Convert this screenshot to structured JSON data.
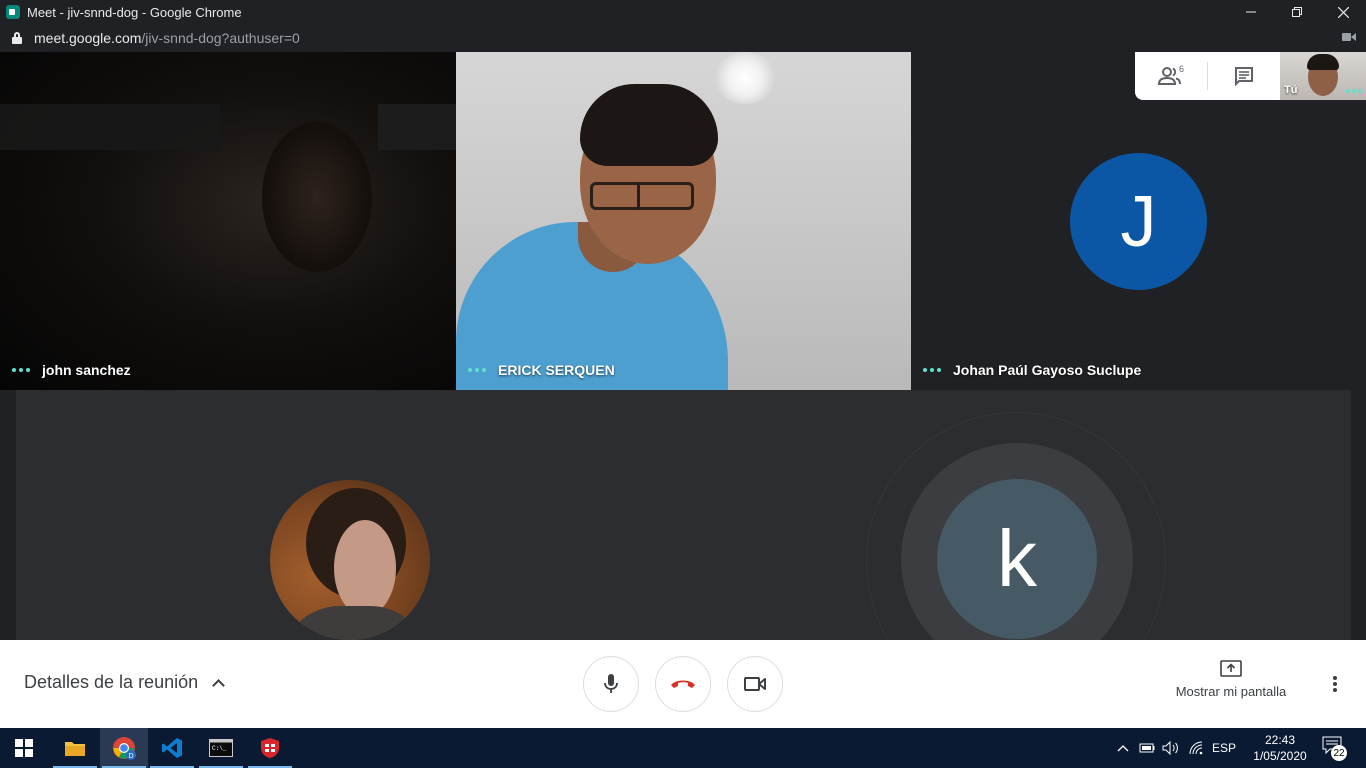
{
  "window": {
    "title": "Meet - jiv-snnd-dog - Google Chrome",
    "url_host": "meet.google.com",
    "url_path": "/jiv-snnd-dog?authuser=0"
  },
  "participants": [
    {
      "name": "john sanchez"
    },
    {
      "name": "ERICK SERQUEN"
    },
    {
      "name": "Johan Paúl Gayoso Suclupe",
      "initial": "J",
      "avatar_color": "#0b57a5"
    },
    {
      "name": "",
      "initial": "k",
      "avatar_color": "#455a64"
    }
  ],
  "top_panel": {
    "people_count": "6",
    "self_label": "Tú"
  },
  "controls": {
    "details_label": "Detalles de la reunión",
    "present_label": "Mostrar mi pantalla",
    "end_call_color": "#d93025"
  },
  "taskbar": {
    "language": "ESP",
    "time": "22:43",
    "date": "1/05/2020",
    "notifications": "22"
  },
  "colors": {
    "accent_dots": "#5fe1cf",
    "stage_bg": "#202124"
  }
}
